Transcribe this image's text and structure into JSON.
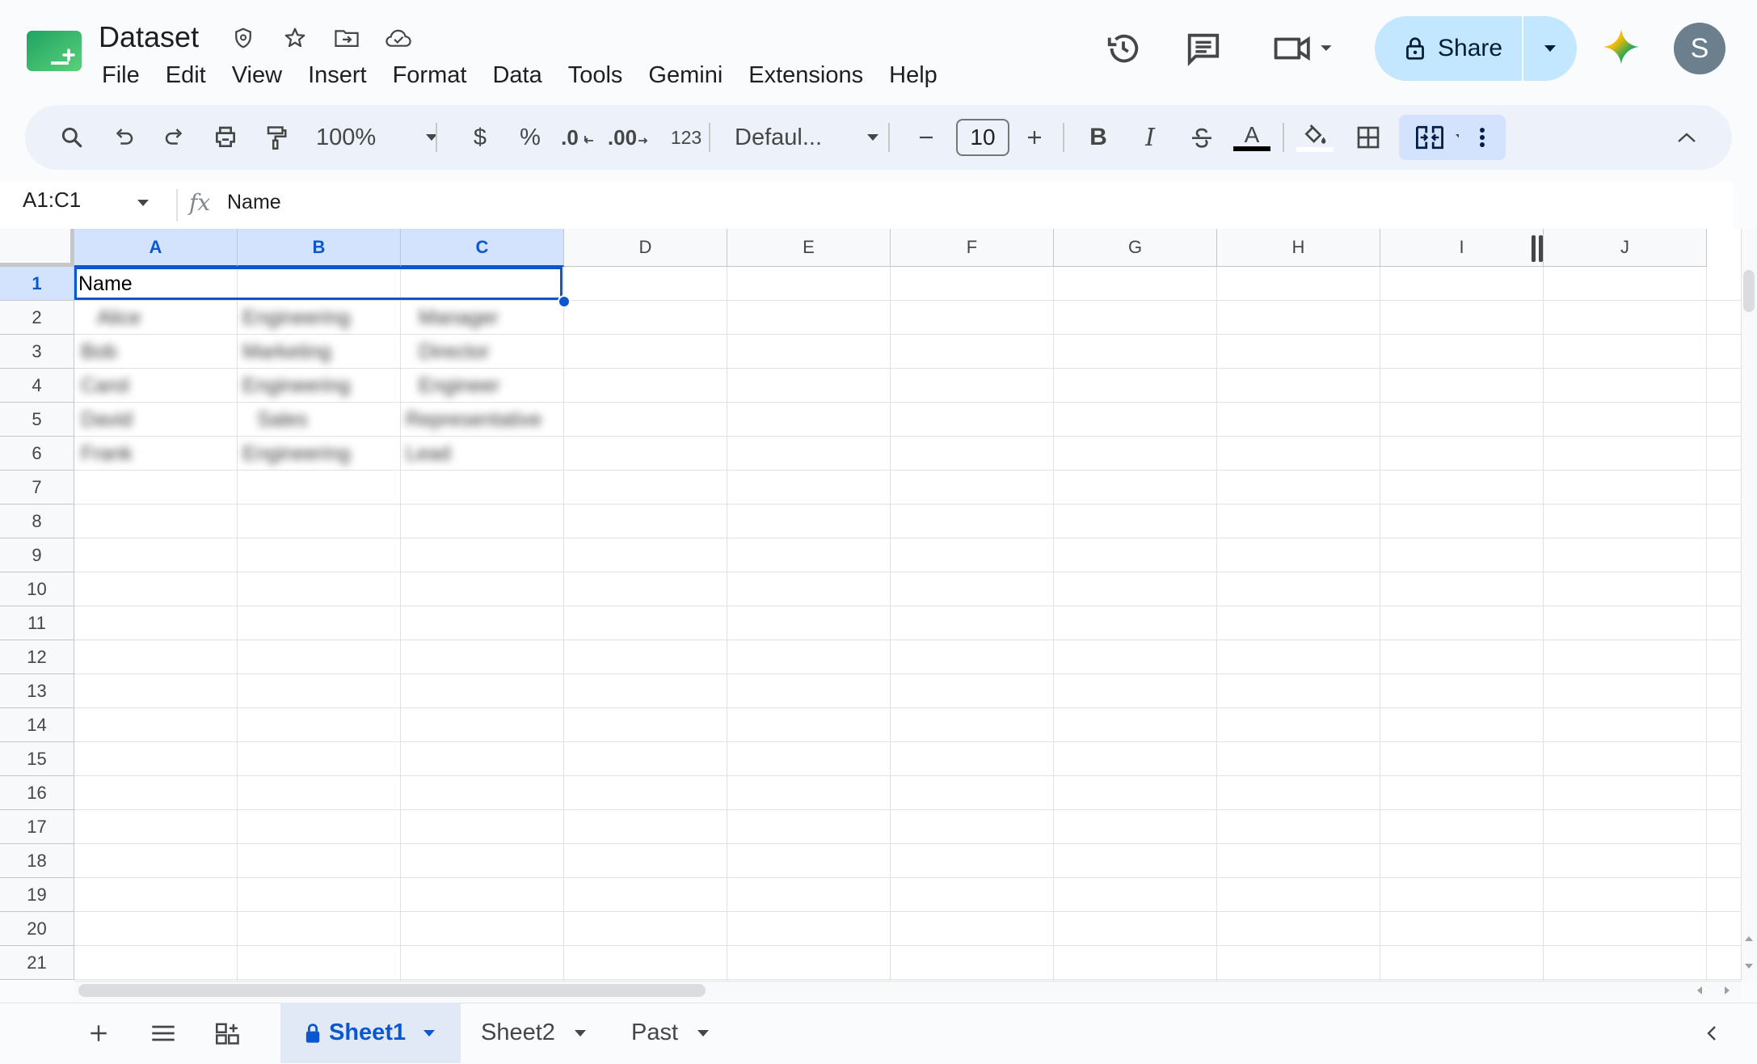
{
  "doc": {
    "title": "Dataset",
    "icons": [
      "move-doc-icon",
      "star-icon",
      "move-folder-icon",
      "cloud-saved-icon"
    ]
  },
  "menu": [
    "File",
    "Edit",
    "View",
    "Insert",
    "Format",
    "Data",
    "Tools",
    "Gemini",
    "Extensions",
    "Help"
  ],
  "header_right": {
    "icons": [
      "history-icon",
      "comments-icon",
      "meet-icon",
      "gemini-icon"
    ],
    "share_label": "Share",
    "avatar_initial": "S"
  },
  "toolbar": {
    "zoom": "100%",
    "currency": "$",
    "percent": "%",
    "decrease_decimal": ".0",
    "increase_decimal": ".00",
    "number_format": "123",
    "font": "Defaul...",
    "font_size": "10",
    "bold": "B",
    "italic": "I",
    "text_color_letter": "A",
    "colors": {
      "text_color_bar": "#000000",
      "accent": "#0b57d0",
      "active_button": "#d3e3fd"
    }
  },
  "formula": {
    "name_box": "A1:C1",
    "fx": "fx",
    "value": "Name"
  },
  "grid": {
    "columns": [
      "A",
      "B",
      "C",
      "D",
      "E",
      "F",
      "G",
      "H",
      "I",
      "J"
    ],
    "selected_columns": [
      "A",
      "B",
      "C"
    ],
    "rows": [
      "1",
      "2",
      "3",
      "4",
      "5",
      "6",
      "7",
      "8",
      "9",
      "10",
      "11",
      "12",
      "13",
      "14",
      "15",
      "16",
      "17",
      "18",
      "19",
      "20",
      "21"
    ],
    "selected_row": "1",
    "a1_text": "Name",
    "blurred_rows": [
      [
        "Alice",
        "Engineering",
        "Manager"
      ],
      [
        "Bob",
        "Marketing",
        "Director"
      ],
      [
        "Carol",
        "Engineering",
        "Engineer"
      ],
      [
        "David",
        "Sales",
        "Representative"
      ],
      [
        "Frank",
        "Engineering",
        "Lead"
      ]
    ]
  },
  "sheets": {
    "tabs": [
      {
        "label": "Sheet1",
        "active": true,
        "locked": true
      },
      {
        "label": "Sheet2",
        "active": false,
        "locked": false
      },
      {
        "label": "Past",
        "active": false,
        "locked": false
      }
    ]
  }
}
